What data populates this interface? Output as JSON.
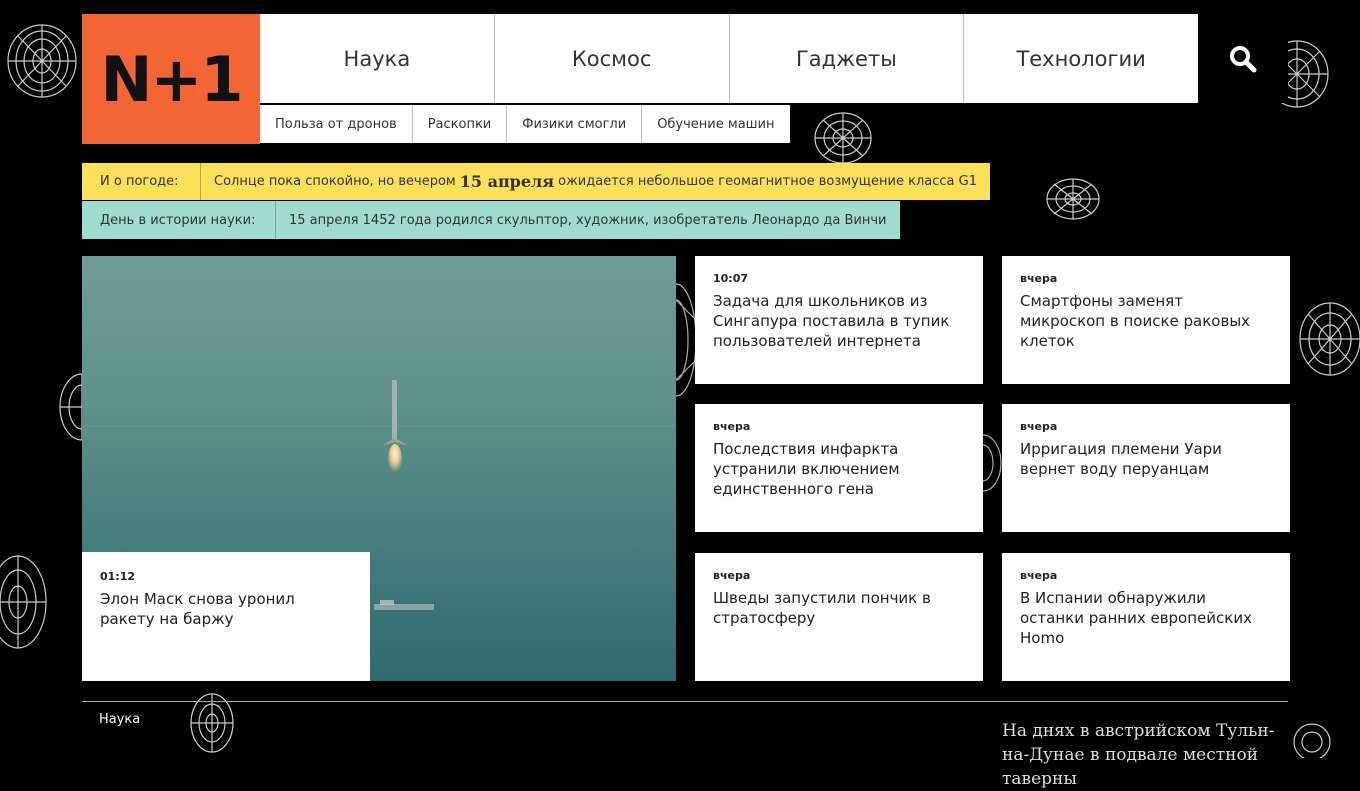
{
  "logo": {
    "text": "N+1",
    "color": "#f26534"
  },
  "nav": {
    "items": [
      "Наука",
      "Космос",
      "Гаджеты",
      "Технологии"
    ],
    "search_icon": "search-icon"
  },
  "subnav": {
    "items": [
      "Польза от дронов",
      "Раскопки",
      "Физики смогли",
      "Обучение машин"
    ]
  },
  "weather": {
    "label": "И о погоде:",
    "text_before": "Солнце пока спокойно, но вечером",
    "date": "15 апреля",
    "text_after": "ожидается небольшое геомагнитное возмущение класса G1",
    "color": "#fde15a"
  },
  "history": {
    "label": "День в истории науки:",
    "text": "15 апреля 1452 года родился скульптор, художник, изобретатель Леонардо да Винчи",
    "color": "#9fdcce"
  },
  "hero": {
    "time": "01:12",
    "title": "Элон Маск снова уронил ракету на баржу"
  },
  "cards": [
    {
      "time": "10:07",
      "title": "Задача для школьников из Сингапура поставила в тупик пользователей интернета"
    },
    {
      "time": "вчера",
      "title": "Смартфоны заменят микроскоп в поиске раковых клеток"
    },
    {
      "time": "вчера",
      "title": "Последствия инфаркта устранили включением единственного гена"
    },
    {
      "time": "вчера",
      "title": "Ирригация племени Уари вернет воду перуанцам"
    },
    {
      "time": "вчера",
      "title": "Шведы запустили пончик в стратосферу"
    },
    {
      "time": "вчера",
      "title": "В Испании обнаружили останки ранних европейских Homo"
    }
  ],
  "footer": {
    "section": "Наука",
    "teaser": "На днях в австрийском Тульн-на-Дунае в подвале местной таверны"
  }
}
